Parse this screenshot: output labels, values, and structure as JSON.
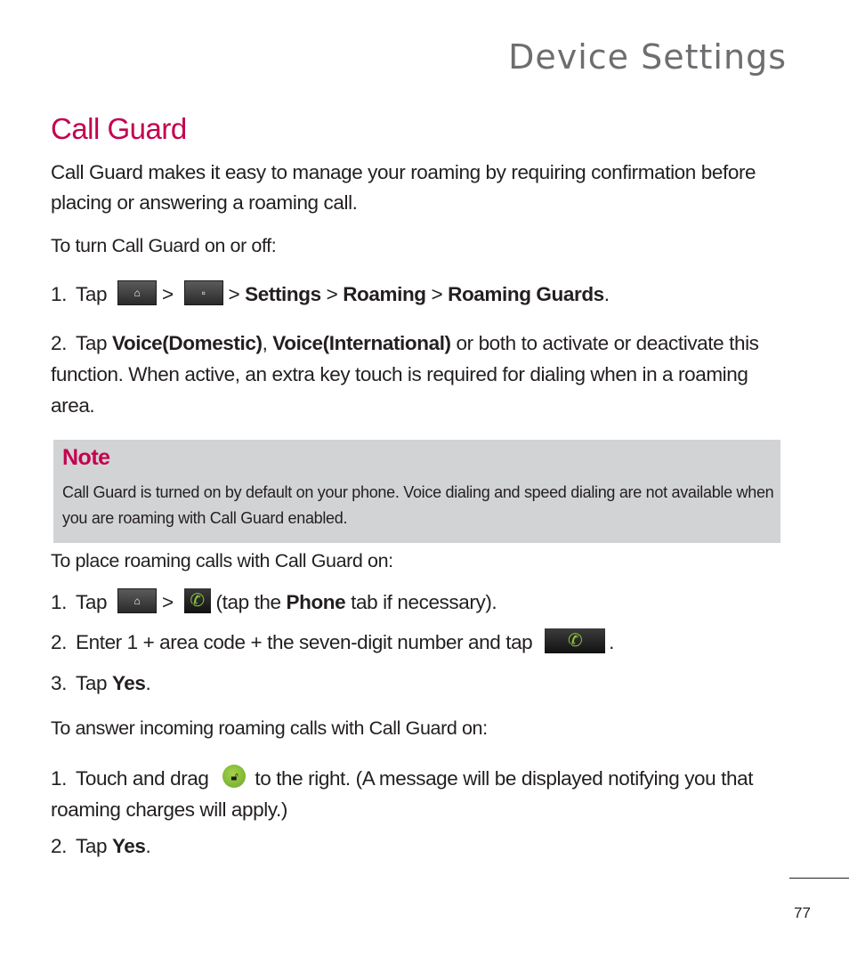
{
  "header": {
    "title": "Device Settings"
  },
  "section": {
    "title": "Call Guard",
    "intro": "Call Guard makes it easy to manage your roaming by requiring confirmation before placing or answering a roaming call."
  },
  "turn_on_off": {
    "heading": "To turn Call Guard on or off:",
    "step1": {
      "num": "1.",
      "tap": "Tap",
      "sep": ">",
      "icons": [
        "home-key-icon",
        "applications-key-icon"
      ],
      "path": [
        "Settings",
        "Roaming",
        "Roaming Guards"
      ],
      "end": "."
    },
    "step2": {
      "num": "2.",
      "tap": "Tap",
      "option1": "Voice(Domestic)",
      "comma": ",",
      "option2": "Voice(International)",
      "rest": "or both to activate or deactivate this function. When active, an extra key touch is required for dialing when in a roaming area."
    }
  },
  "note": {
    "title": "Note",
    "body": "Call Guard is turned on by default on your phone. Voice dialing and speed dialing are not available when you are roaming with Call Guard enabled."
  },
  "place_calls": {
    "heading": "To place roaming calls with Call Guard on:",
    "step1": {
      "num": "1.",
      "tap": "Tap",
      "sep": ">",
      "pre": "(tap the",
      "bold": "Phone",
      "post": "tab if necessary)."
    },
    "step2": {
      "num": "2.",
      "text": "Enter 1 + area code + the seven-digit number and tap",
      "end": "."
    },
    "step3": {
      "num": "3.",
      "tap": "Tap",
      "bold": "Yes",
      "end": "."
    }
  },
  "answer_calls": {
    "heading": "To answer incoming roaming calls with Call Guard on:",
    "step1": {
      "num": "1.",
      "pre": "Touch and drag",
      "post": "to the right. (A message will be displayed notifying you that roaming charges will apply.)"
    },
    "step2": {
      "num": "2.",
      "tap": "Tap",
      "bold": "Yes",
      "end": "."
    }
  },
  "colors": {
    "accent": "#c4004f",
    "note_bg": "#d2d3d5",
    "header_gray": "#6d6e70",
    "phone_green": "#8cc63f"
  },
  "footer": {
    "page_number": "77"
  }
}
